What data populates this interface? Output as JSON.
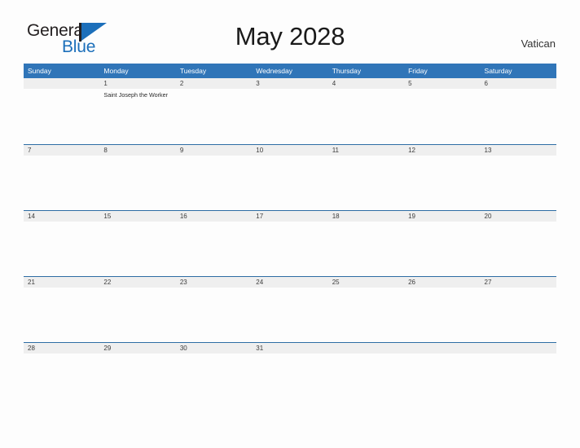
{
  "brand": {
    "name_part1": "General",
    "name_part2": "Blue",
    "flag_icon": "flag-triangle-icon",
    "color_primary": "#1c6fba",
    "color_text": "#231f20"
  },
  "header": {
    "title": "May 2028",
    "region": "Vatican"
  },
  "calendar": {
    "month": "May",
    "year": "2028",
    "accent_color": "#3075b8",
    "band_color": "#efefef",
    "row_border_color": "#2e6da4",
    "day_headers": [
      "Sunday",
      "Monday",
      "Tuesday",
      "Wednesday",
      "Thursday",
      "Friday",
      "Saturday"
    ],
    "weeks": [
      {
        "days": [
          {
            "date": "",
            "events": []
          },
          {
            "date": "1",
            "events": [
              "Saint Joseph the Worker"
            ]
          },
          {
            "date": "2",
            "events": []
          },
          {
            "date": "3",
            "events": []
          },
          {
            "date": "4",
            "events": []
          },
          {
            "date": "5",
            "events": []
          },
          {
            "date": "6",
            "events": []
          }
        ]
      },
      {
        "days": [
          {
            "date": "7",
            "events": []
          },
          {
            "date": "8",
            "events": []
          },
          {
            "date": "9",
            "events": []
          },
          {
            "date": "10",
            "events": []
          },
          {
            "date": "11",
            "events": []
          },
          {
            "date": "12",
            "events": []
          },
          {
            "date": "13",
            "events": []
          }
        ]
      },
      {
        "days": [
          {
            "date": "14",
            "events": []
          },
          {
            "date": "15",
            "events": []
          },
          {
            "date": "16",
            "events": []
          },
          {
            "date": "17",
            "events": []
          },
          {
            "date": "18",
            "events": []
          },
          {
            "date": "19",
            "events": []
          },
          {
            "date": "20",
            "events": []
          }
        ]
      },
      {
        "days": [
          {
            "date": "21",
            "events": []
          },
          {
            "date": "22",
            "events": []
          },
          {
            "date": "23",
            "events": []
          },
          {
            "date": "24",
            "events": []
          },
          {
            "date": "25",
            "events": []
          },
          {
            "date": "26",
            "events": []
          },
          {
            "date": "27",
            "events": []
          }
        ]
      },
      {
        "days": [
          {
            "date": "28",
            "events": []
          },
          {
            "date": "29",
            "events": []
          },
          {
            "date": "30",
            "events": []
          },
          {
            "date": "31",
            "events": []
          },
          {
            "date": "",
            "events": []
          },
          {
            "date": "",
            "events": []
          },
          {
            "date": "",
            "events": []
          }
        ]
      }
    ]
  }
}
